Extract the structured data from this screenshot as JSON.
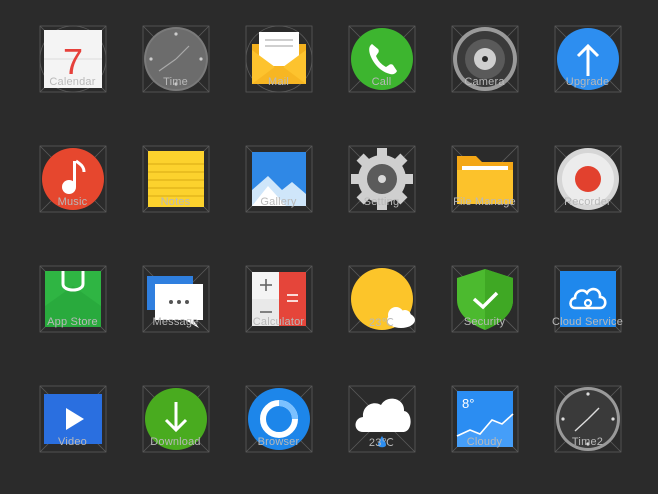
{
  "icons": [
    {
      "id": "calendar",
      "label": "Calendar",
      "icon": "calendar-icon",
      "day": "7"
    },
    {
      "id": "time",
      "label": "Time",
      "icon": "clock-icon"
    },
    {
      "id": "mail",
      "label": "Mail",
      "icon": "mail-icon"
    },
    {
      "id": "call",
      "label": "Call",
      "icon": "phone-icon"
    },
    {
      "id": "camera",
      "label": "Camera",
      "icon": "camera-icon"
    },
    {
      "id": "upgrade",
      "label": "Upgrade",
      "icon": "upgrade-arrow-icon"
    },
    {
      "id": "music",
      "label": "Music",
      "icon": "music-note-icon"
    },
    {
      "id": "notes",
      "label": "Notes",
      "icon": "notes-icon"
    },
    {
      "id": "gallery",
      "label": "Gallery",
      "icon": "gallery-icon"
    },
    {
      "id": "setting",
      "label": "Setting",
      "icon": "gear-icon"
    },
    {
      "id": "file-manage",
      "label": "File Manage",
      "icon": "folder-icon"
    },
    {
      "id": "recorder",
      "label": "Recorder",
      "icon": "record-icon"
    },
    {
      "id": "app-store",
      "label": "App Store",
      "icon": "shopping-bag-icon"
    },
    {
      "id": "message",
      "label": "Message",
      "icon": "message-bubble-icon"
    },
    {
      "id": "calculator",
      "label": "Calculator",
      "icon": "calculator-icon"
    },
    {
      "id": "weather-sun",
      "label": "23℃",
      "icon": "sun-cloud-icon"
    },
    {
      "id": "security",
      "label": "Security",
      "icon": "shield-check-icon"
    },
    {
      "id": "cloud-service",
      "label": "Cloud Service",
      "icon": "cloud-service-icon"
    },
    {
      "id": "video",
      "label": "Video",
      "icon": "play-icon"
    },
    {
      "id": "download",
      "label": "Download",
      "icon": "download-arrow-icon"
    },
    {
      "id": "browser",
      "label": "Browser",
      "icon": "browser-ring-icon"
    },
    {
      "id": "weather-rain",
      "label": "23℃",
      "icon": "rain-cloud-icon"
    },
    {
      "id": "cloudy",
      "label": "Cloudy",
      "icon": "weather-chart-icon",
      "temp": "8°"
    },
    {
      "id": "time2",
      "label": "Time2",
      "icon": "clock-dark-icon"
    }
  ],
  "colors": {
    "background": "#2b2b2b",
    "label": "#b9b9b9",
    "guide": "#5a5a5a"
  }
}
